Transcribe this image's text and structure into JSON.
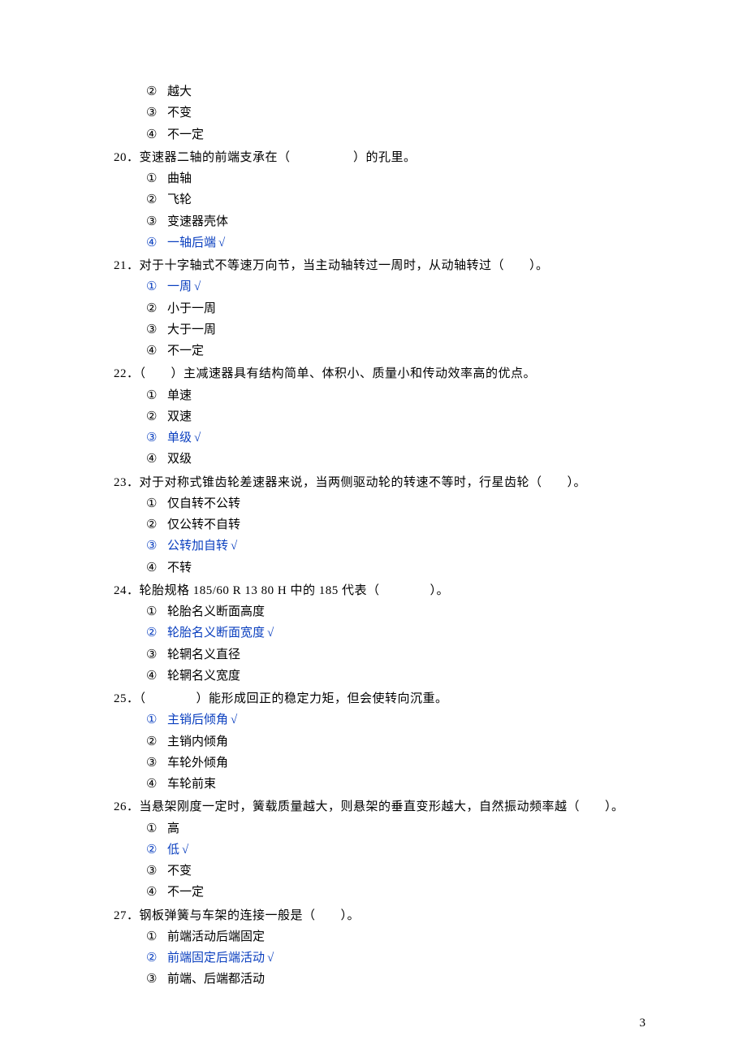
{
  "frag19": {
    "opts": [
      {
        "m": "②",
        "t": "越大",
        "c": false
      },
      {
        "m": "③",
        "t": "不变",
        "c": false
      },
      {
        "m": "④",
        "t": "不一定",
        "c": false
      }
    ]
  },
  "q20": {
    "stem": "20．变速器二轴的前端支承在（　　　　　）的孔里。",
    "opts": [
      {
        "m": "①",
        "t": "曲轴",
        "c": false
      },
      {
        "m": "②",
        "t": "飞轮",
        "c": false
      },
      {
        "m": "③",
        "t": "变速器壳体",
        "c": false
      },
      {
        "m": "④",
        "t": "一轴后端",
        "c": true
      }
    ]
  },
  "q21": {
    "stem": "21．对于十字轴式不等速万向节，当主动轴转过一周时，从动轴转过（　　）。",
    "opts": [
      {
        "m": "①",
        "t": "一周",
        "c": true
      },
      {
        "m": "②",
        "t": "小于一周",
        "c": false
      },
      {
        "m": "③",
        "t": "大于一周",
        "c": false
      },
      {
        "m": "④",
        "t": "不一定",
        "c": false
      }
    ]
  },
  "q22": {
    "stem": "22．（　　）主减速器具有结构简单、体积小、质量小和传动效率高的优点。",
    "opts": [
      {
        "m": "①",
        "t": "单速",
        "c": false
      },
      {
        "m": "②",
        "t": "双速",
        "c": false
      },
      {
        "m": "③",
        "t": "单级",
        "c": true
      },
      {
        "m": "④",
        "t": "双级",
        "c": false
      }
    ]
  },
  "q23": {
    "stem": "23．对于对称式锥齿轮差速器来说，当两侧驱动轮的转速不等时，行星齿轮（　　）。",
    "opts": [
      {
        "m": "①",
        "t": "仅自转不公转",
        "c": false
      },
      {
        "m": "②",
        "t": "仅公转不自转",
        "c": false
      },
      {
        "m": "③",
        "t": "公转加自转",
        "c": true
      },
      {
        "m": "④",
        "t": "不转",
        "c": false
      }
    ]
  },
  "q24": {
    "stem": "24．轮胎规格 185/60 R 13 80 H 中的 185 代表（　　　　）。",
    "opts": [
      {
        "m": "①",
        "t": "轮胎名义断面高度",
        "c": false
      },
      {
        "m": "②",
        "t": "轮胎名义断面宽度",
        "c": true
      },
      {
        "m": "③",
        "t": "轮辋名义直径",
        "c": false
      },
      {
        "m": "④",
        "t": "轮辋名义宽度",
        "c": false
      }
    ]
  },
  "q25": {
    "stem": "25．（　　　　）能形成回正的稳定力矩，但会使转向沉重。",
    "opts": [
      {
        "m": "①",
        "t": "主销后倾角",
        "c": true
      },
      {
        "m": "②",
        "t": "主销内倾角",
        "c": false
      },
      {
        "m": "③",
        "t": "车轮外倾角",
        "c": false
      },
      {
        "m": "④",
        "t": "车轮前束",
        "c": false
      }
    ]
  },
  "q26": {
    "stem": "26．当悬架刚度一定时，簧载质量越大，则悬架的垂直变形越大，自然振动频率越（　　）。",
    "opts": [
      {
        "m": "①",
        "t": "高",
        "c": false
      },
      {
        "m": "②",
        "t": "低",
        "c": true
      },
      {
        "m": "③",
        "t": "不变",
        "c": false
      },
      {
        "m": "④",
        "t": "不一定",
        "c": false
      }
    ]
  },
  "q27": {
    "stem": "27．钢板弹簧与车架的连接一般是（　　）。",
    "opts": [
      {
        "m": "①",
        "t": "前端活动后端固定",
        "c": false
      },
      {
        "m": "②",
        "t": "前端固定后端活动",
        "c": true
      },
      {
        "m": "③",
        "t": "前端、后端都活动",
        "c": false
      }
    ]
  },
  "checkmark": "√",
  "pagenum": "3"
}
